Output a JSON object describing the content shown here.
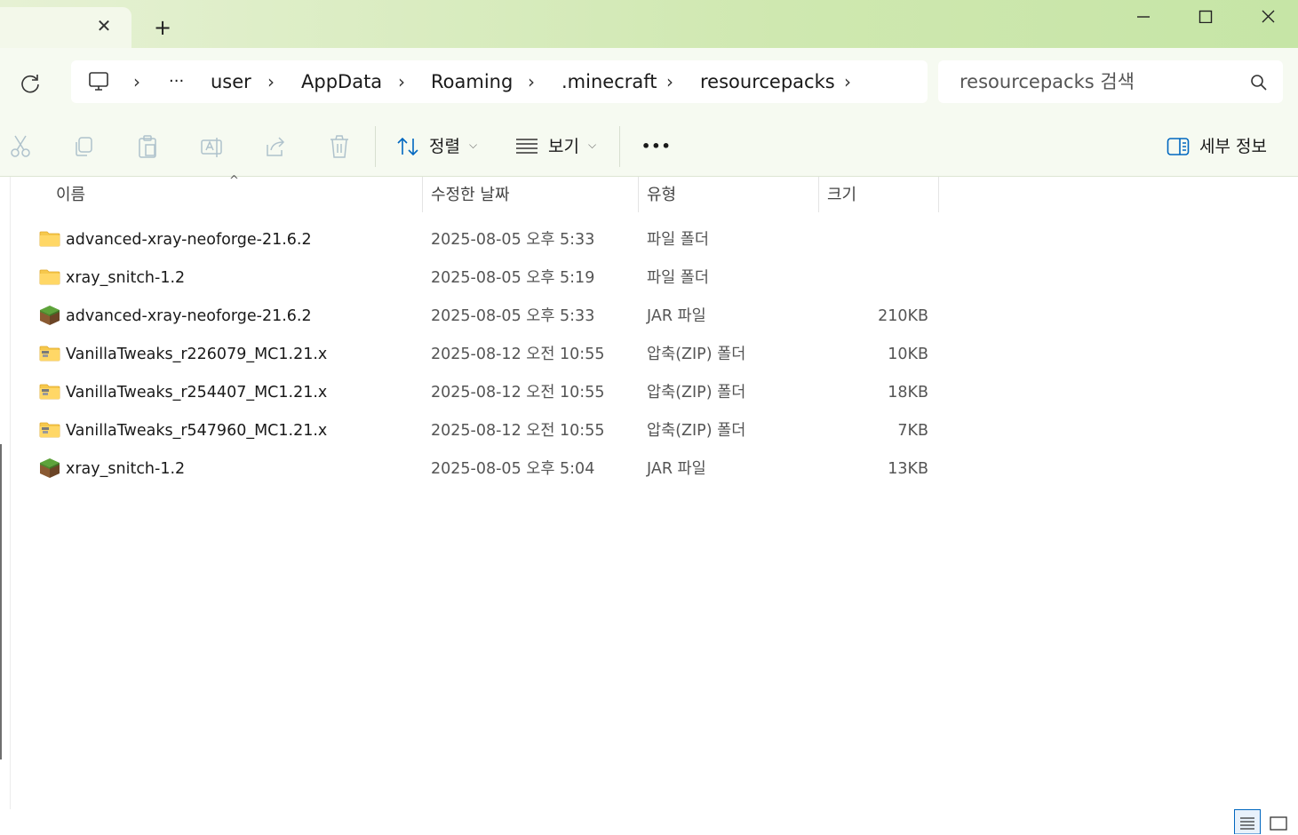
{
  "window": {
    "tab_close": "✕",
    "new_tab": "+",
    "minimize": "—",
    "maximize": "☐",
    "close": "✕"
  },
  "address": {
    "overflow": "···",
    "crumbs": [
      "user",
      "AppData",
      "Roaming",
      ".minecraft",
      "resourcepacks"
    ],
    "separator": "›"
  },
  "search": {
    "placeholder": "resourcepacks 검색"
  },
  "toolbar": {
    "sort_label": "정렬",
    "view_label": "보기",
    "more_label": "•••",
    "details_label": "세부 정보"
  },
  "columns": {
    "name": "이름",
    "date": "수정한 날짜",
    "type": "유형",
    "size": "크기"
  },
  "files": [
    {
      "icon": "folder-icon",
      "name": "advanced-xray-neoforge-21.6.2",
      "date": "2025-08-05 오후 5:33",
      "type": "파일 폴더",
      "size": ""
    },
    {
      "icon": "folder-icon",
      "name": "xray_snitch-1.2",
      "date": "2025-08-05 오후 5:19",
      "type": "파일 폴더",
      "size": ""
    },
    {
      "icon": "jar-icon",
      "name": "advanced-xray-neoforge-21.6.2",
      "date": "2025-08-05 오후 5:33",
      "type": "JAR 파일",
      "size": "210KB"
    },
    {
      "icon": "zip-folder-icon",
      "name": "VanillaTweaks_r226079_MC1.21.x",
      "date": "2025-08-12 오전 10:55",
      "type": "압축(ZIP) 폴더",
      "size": "10KB"
    },
    {
      "icon": "zip-folder-icon",
      "name": "VanillaTweaks_r254407_MC1.21.x",
      "date": "2025-08-12 오전 10:55",
      "type": "압축(ZIP) 폴더",
      "size": "18KB"
    },
    {
      "icon": "zip-folder-icon",
      "name": "VanillaTweaks_r547960_MC1.21.x",
      "date": "2025-08-12 오전 10:55",
      "type": "압축(ZIP) 폴더",
      "size": "7KB"
    },
    {
      "icon": "jar-icon",
      "name": "xray_snitch-1.2",
      "date": "2025-08-05 오후 5:04",
      "type": "JAR 파일",
      "size": "13KB"
    }
  ],
  "colors": {
    "title_gradient_start": "#e6f1d4",
    "title_gradient_end": "#c6e5a6",
    "folder": "#f6c84c",
    "accent": "#0067c0"
  }
}
